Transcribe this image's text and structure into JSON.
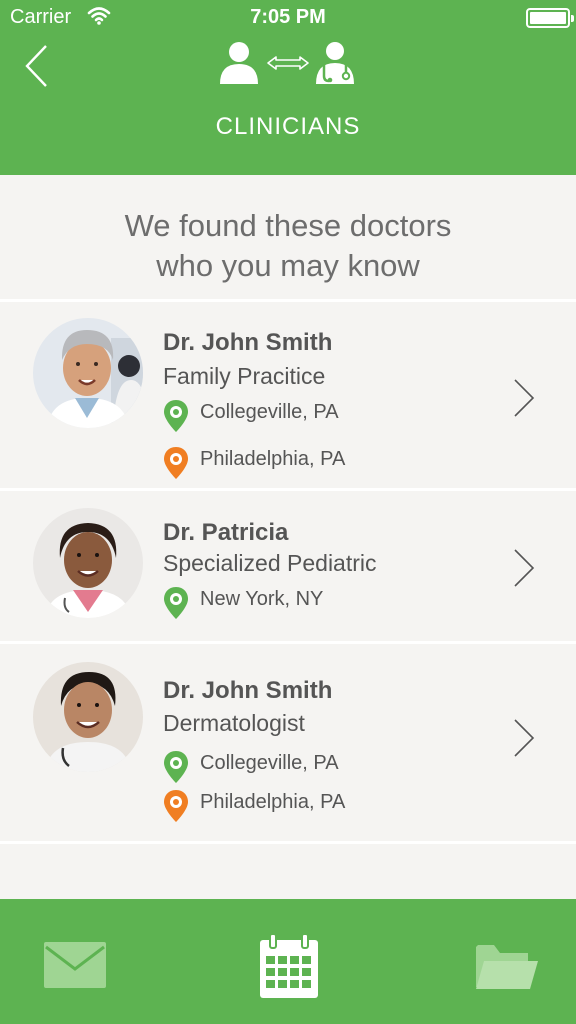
{
  "status_bar": {
    "carrier": "Carrier",
    "time": "7:05 PM"
  },
  "header": {
    "title": "CLINICIANS",
    "back_icon": "chevron-left-icon",
    "logo_icon": "patient-doctor-link-icon"
  },
  "intro": {
    "line1": "We found these doctors",
    "line2": "who you may know"
  },
  "doctors": [
    {
      "name": "Dr. John Smith",
      "specialty": "Family Pracitice",
      "locations": [
        {
          "label": "Collegeville, PA",
          "color": "#5db351"
        },
        {
          "label": "Philadelphia, PA",
          "color": "#f07e22"
        }
      ]
    },
    {
      "name": "Dr. Patricia",
      "specialty": "Specialized Pediatric",
      "locations": [
        {
          "label": "New York, NY",
          "color": "#5db351"
        }
      ]
    },
    {
      "name": "Dr. John Smith",
      "specialty": "Dermatologist",
      "locations": [
        {
          "label": "Collegeville, PA",
          "color": "#5db351"
        },
        {
          "label": "Philadelphia, PA",
          "color": "#f07e22"
        }
      ]
    }
  ],
  "tabs": [
    {
      "icon": "mail-icon",
      "active": false
    },
    {
      "icon": "calendar-icon",
      "active": true
    },
    {
      "icon": "folder-icon",
      "active": false
    }
  ],
  "colors": {
    "brand_green": "#5db351",
    "pin_green": "#5db351",
    "pin_orange": "#f07e22",
    "text_gray": "#555555"
  }
}
